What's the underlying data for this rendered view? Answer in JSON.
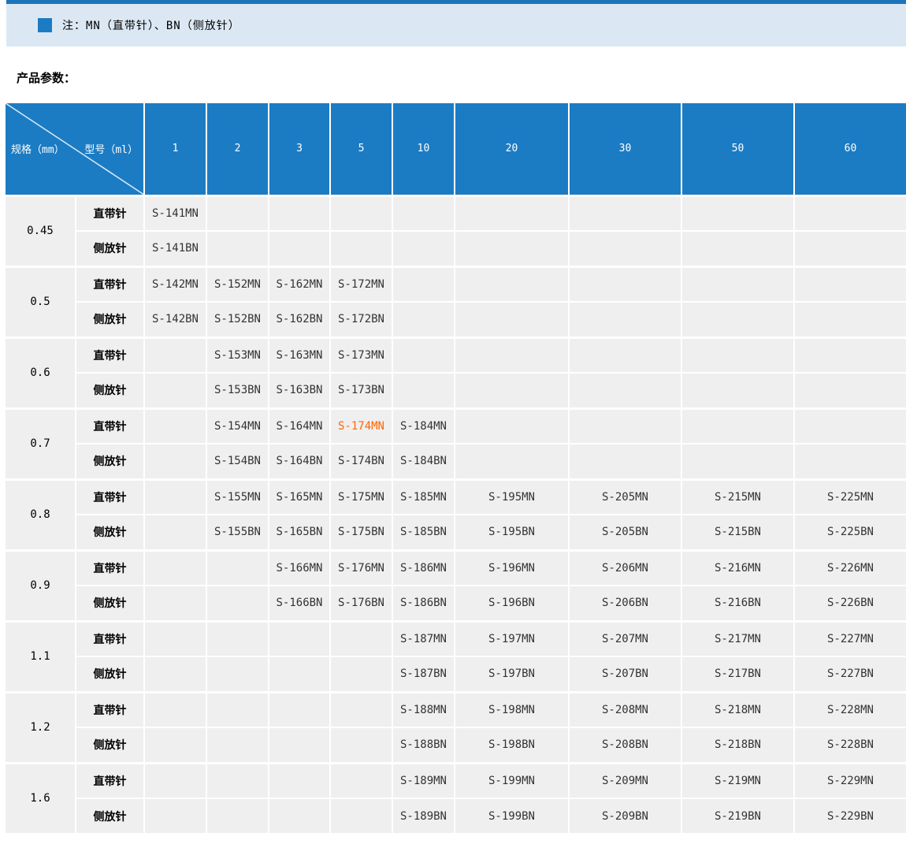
{
  "note": {
    "text": "注：MN（直带针）、BN（侧放针）"
  },
  "section_title": "产品参数：",
  "colors": {
    "accent_blue": "#1b7cc4",
    "note_bar_bg": "#dbe8f4",
    "note_bar_top_border": "#1c73b9",
    "body_cell_bg": "#efefef",
    "model_text": "#333333",
    "highlight_orange": "#ff6600"
  },
  "table": {
    "corner": {
      "left": "规格（mm）",
      "right": "型号（ml）"
    },
    "volume_headers": [
      "1",
      "2",
      "3",
      "5",
      "10",
      "20",
      "30",
      "50",
      "60"
    ],
    "row_type_labels": [
      "直带针",
      "侧放针"
    ],
    "highlighted_model": "S-174MN",
    "groups": [
      {
        "spec": "0.45",
        "mn": [
          "S-141MN",
          "",
          "",
          "",
          "",
          "",
          "",
          "",
          ""
        ],
        "bn": [
          "S-141BN",
          "",
          "",
          "",
          "",
          "",
          "",
          "",
          ""
        ]
      },
      {
        "spec": "0.5",
        "mn": [
          "S-142MN",
          "S-152MN",
          "S-162MN",
          "S-172MN",
          "",
          "",
          "",
          "",
          ""
        ],
        "bn": [
          "S-142BN",
          "S-152BN",
          "S-162BN",
          "S-172BN",
          "",
          "",
          "",
          "",
          ""
        ]
      },
      {
        "spec": "0.6",
        "mn": [
          "",
          "S-153MN",
          "S-163MN",
          "S-173MN",
          "",
          "",
          "",
          "",
          ""
        ],
        "bn": [
          "",
          "S-153BN",
          "S-163BN",
          "S-173BN",
          "",
          "",
          "",
          "",
          ""
        ]
      },
      {
        "spec": "0.7",
        "mn": [
          "",
          "S-154MN",
          "S-164MN",
          "S-174MN",
          "S-184MN",
          "",
          "",
          "",
          ""
        ],
        "bn": [
          "",
          "S-154BN",
          "S-164BN",
          "S-174BN",
          "S-184BN",
          "",
          "",
          "",
          ""
        ]
      },
      {
        "spec": "0.8",
        "mn": [
          "",
          "S-155MN",
          "S-165MN",
          "S-175MN",
          "S-185MN",
          "S-195MN",
          "S-205MN",
          "S-215MN",
          "S-225MN"
        ],
        "bn": [
          "",
          "S-155BN",
          "S-165BN",
          "S-175BN",
          "S-185BN",
          "S-195BN",
          "S-205BN",
          "S-215BN",
          "S-225BN"
        ]
      },
      {
        "spec": "0.9",
        "mn": [
          "",
          "",
          "S-166MN",
          "S-176MN",
          "S-186MN",
          "S-196MN",
          "S-206MN",
          "S-216MN",
          "S-226MN"
        ],
        "bn": [
          "",
          "",
          "S-166BN",
          "S-176BN",
          "S-186BN",
          "S-196BN",
          "S-206BN",
          "S-216BN",
          "S-226BN"
        ]
      },
      {
        "spec": "1.1",
        "mn": [
          "",
          "",
          "",
          "",
          "S-187MN",
          "S-197MN",
          "S-207MN",
          "S-217MN",
          "S-227MN"
        ],
        "bn": [
          "",
          "",
          "",
          "",
          "S-187BN",
          "S-197BN",
          "S-207BN",
          "S-217BN",
          "S-227BN"
        ]
      },
      {
        "spec": "1.2",
        "mn": [
          "",
          "",
          "",
          "",
          "S-188MN",
          "S-198MN",
          "S-208MN",
          "S-218MN",
          "S-228MN"
        ],
        "bn": [
          "",
          "",
          "",
          "",
          "S-188BN",
          "S-198BN",
          "S-208BN",
          "S-218BN",
          "S-228BN"
        ]
      },
      {
        "spec": "1.6",
        "mn": [
          "",
          "",
          "",
          "",
          "S-189MN",
          "S-199MN",
          "S-209MN",
          "S-219MN",
          "S-229MN"
        ],
        "bn": [
          "",
          "",
          "",
          "",
          "S-189BN",
          "S-199BN",
          "S-209BN",
          "S-219BN",
          "S-229BN"
        ]
      }
    ]
  }
}
